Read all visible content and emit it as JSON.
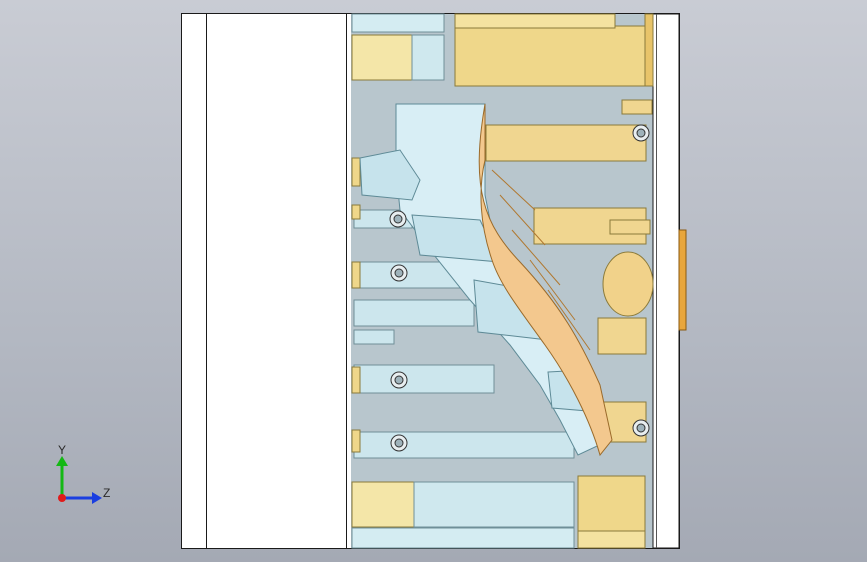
{
  "viewport": {
    "background_top": "#c9ccd4",
    "background_bottom": "#a4a9b4"
  },
  "model": {
    "plate_fill": "#ffffff",
    "plate_stroke": "#1a1a1a",
    "steel_color": "#b7c5cc",
    "cavity_color": "#d6ecf3",
    "pin_color": "#a9dbe6",
    "guide_color": "#efd78a",
    "guide_dark": "#c9a94d",
    "part_color": "#f3c88e",
    "gate_color": "#e8a63c"
  },
  "triad": {
    "y_label": "Y",
    "z_label": "Z",
    "y_color": "#14b814",
    "z_color": "#1a3ee0",
    "x_color": "#e01a1a"
  }
}
